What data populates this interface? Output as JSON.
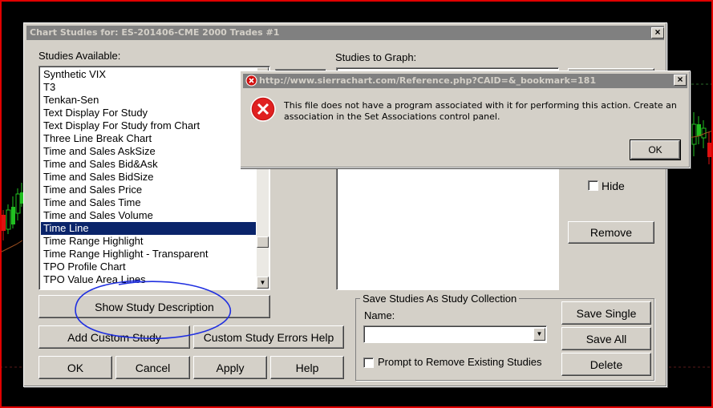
{
  "dialog": {
    "title": "Chart Studies for: ES-201406-CME  2000 Trades  #1",
    "studies_available_label": "Studies Available:",
    "studies_to_graph_label": "Studies to Graph:",
    "studies_list": [
      "Synthetic VIX",
      "T3",
      "Tenkan-Sen",
      "Text Display For Study",
      "Text Display For Study from Chart",
      "Three Line Break Chart",
      "Time and Sales AskSize",
      "Time and Sales Bid&Ask",
      "Time and Sales BidSize",
      "Time and Sales Price",
      "Time and Sales Time",
      "Time and Sales Volume",
      "Time Line",
      "Time Range Highlight",
      "Time Range Highlight - Transparent",
      "TPO Profile Chart",
      "TPO Value Area Lines"
    ],
    "selected_study": "Time Line",
    "buttons": {
      "show_description": "Show Study Description",
      "add_custom": "Add Custom Study",
      "custom_errors": "Custom Study Errors Help",
      "ok": "OK",
      "cancel": "Cancel",
      "apply": "Apply",
      "help": "Help",
      "remove": "Remove",
      "save_single": "Save Single",
      "save_all": "Save All",
      "delete": "Delete"
    },
    "hide_label": "Hide",
    "save_group": {
      "title": "Save Studies As Study Collection",
      "name_label": "Name:",
      "name_value": "",
      "prompt_label": "Prompt to Remove Existing Studies"
    },
    "close_glyph": "×"
  },
  "message_box": {
    "title": "http://www.sierrachart.com/Reference.php?CAID=&_bookmark=181",
    "message": "This file does not have a program associated with it for performing this action. Create an association in the Set Associations control panel.",
    "ok_label": "OK",
    "close_glyph": "×",
    "icon": "error-icon"
  },
  "colors": {
    "frame": "#e00000",
    "selection": "#0a246a",
    "annotation": "#1f2fe0",
    "candle_up": "#21c021",
    "candle_down": "#e01010"
  }
}
